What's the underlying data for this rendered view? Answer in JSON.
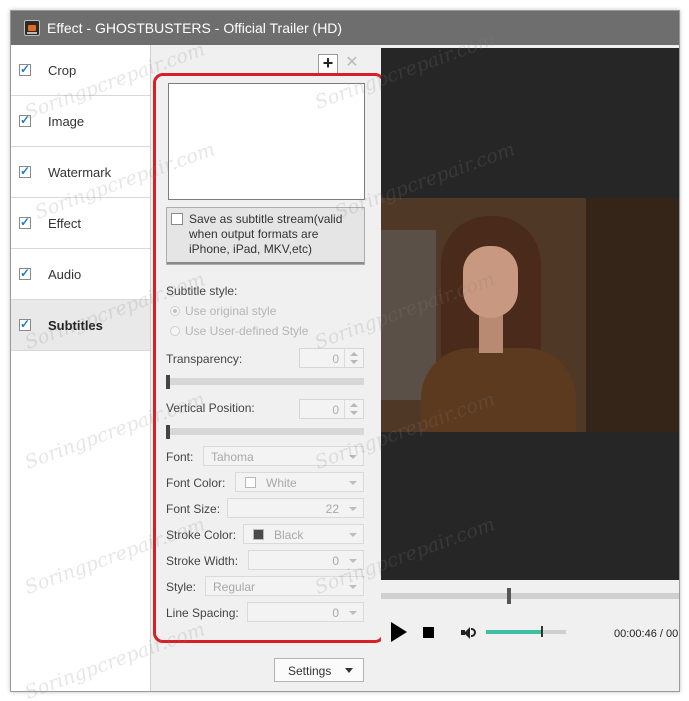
{
  "window": {
    "title": "Effect - GHOSTBUSTERS - Official Trailer (HD)"
  },
  "sidebar": {
    "items": [
      {
        "label": "Crop",
        "checked": true,
        "active": false
      },
      {
        "label": "Image",
        "checked": true,
        "active": false
      },
      {
        "label": "Watermark",
        "checked": true,
        "active": false
      },
      {
        "label": "Effect",
        "checked": true,
        "active": false
      },
      {
        "label": "Audio",
        "checked": true,
        "active": false
      },
      {
        "label": "Subtitles",
        "checked": true,
        "active": true
      }
    ]
  },
  "panel": {
    "add_label": "+",
    "delete_label": "✕",
    "subtitle_stream_label": "Save as subtitle stream(valid when output formats are iPhone, iPad, MKV,etc)",
    "subtitle_style_label": "Subtitle style:",
    "radio_original": "Use original style",
    "radio_user": "Use User-defined Style",
    "transparency": {
      "label": "Transparency:",
      "value": "0",
      "level": 0
    },
    "vertical_position": {
      "label": "Vertical Position:",
      "value": "0",
      "level": 0
    },
    "font": {
      "label": "Font:",
      "value": "Tahoma"
    },
    "font_color": {
      "label": "Font Color:",
      "value": "White",
      "swatch": "#ffffff"
    },
    "font_size": {
      "label": "Font Size:",
      "value": "22"
    },
    "stroke_color": {
      "label": "Stroke Color:",
      "value": "Black",
      "swatch": "#4a4a4a"
    },
    "stroke_width": {
      "label": "Stroke Width:",
      "value": "0"
    },
    "style": {
      "label": "Style:",
      "value": "Regular"
    },
    "line_spacing": {
      "label": "Line Spacing:",
      "value": "0"
    },
    "settings_label": "Settings"
  },
  "player": {
    "time": "00:00:46 / 00",
    "seek_progress": 0.42,
    "volume_level": 0.7
  },
  "watermark_text": "Soringpcrepair.com",
  "colors": {
    "highlight_frame": "#d81f26",
    "titlebar": "#6e6e6e",
    "volume_fill": "#3fbf9f"
  }
}
